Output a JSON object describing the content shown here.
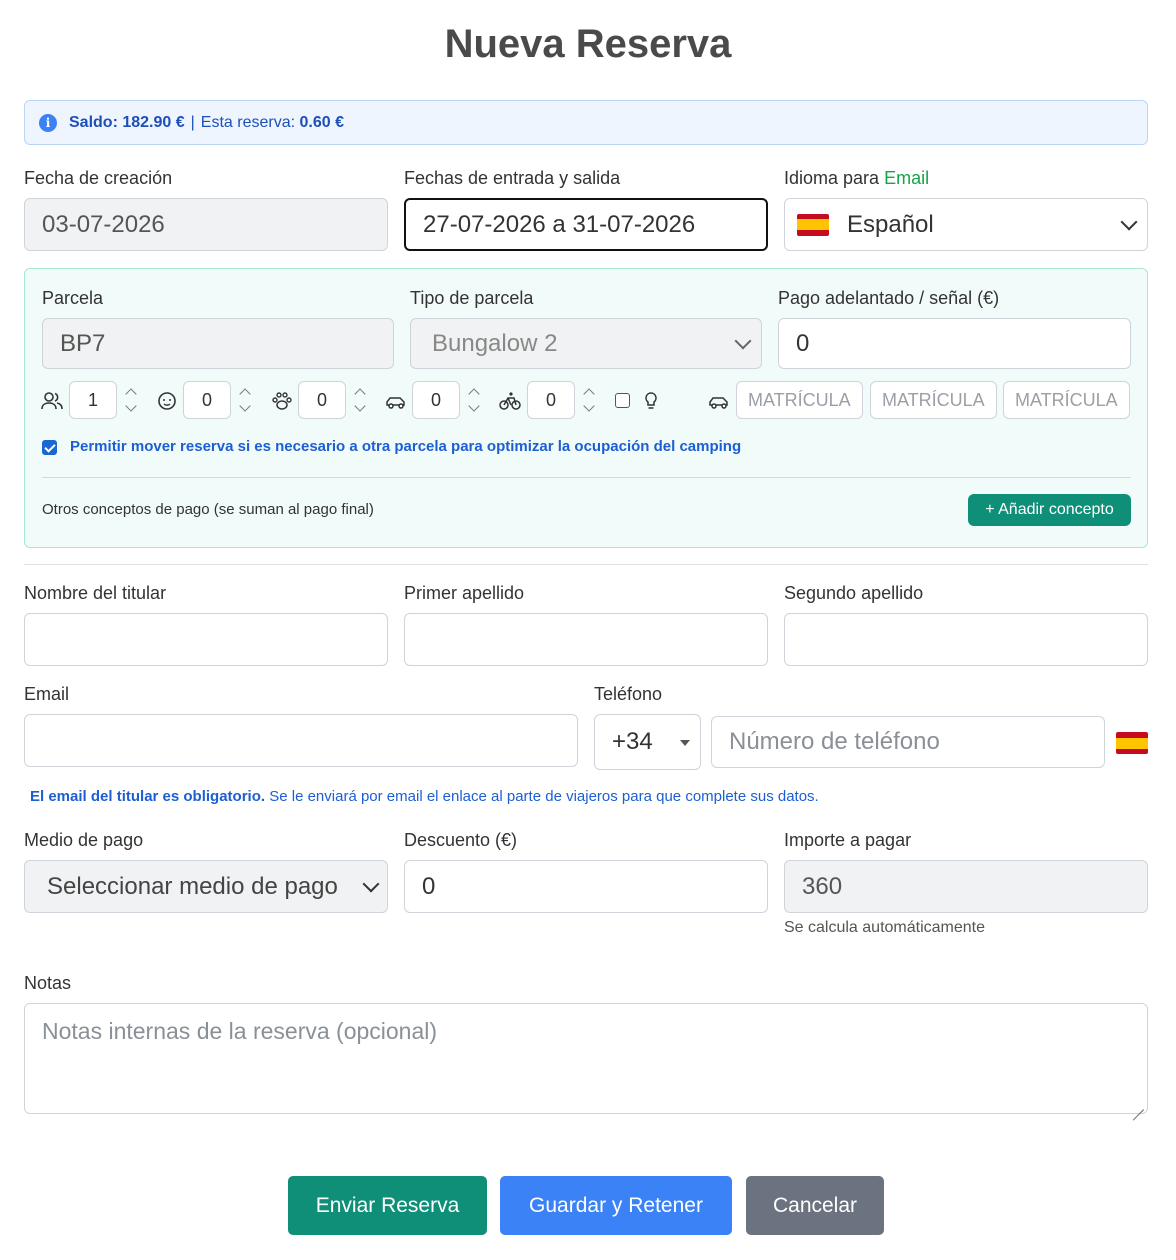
{
  "page": {
    "title": "Nueva Reserva"
  },
  "alert": {
    "saldo": "Saldo: 182.90 €",
    "sep": "|",
    "reserva_label": "Esta reserva:",
    "reserva_value": "0.60 €"
  },
  "fields": {
    "fecha_creacion": {
      "label": "Fecha de creación",
      "value": "03-07-2026"
    },
    "fechas": {
      "label": "Fechas de entrada y salida",
      "value": "27-07-2026 a 31-07-2026"
    },
    "idioma": {
      "label": "Idioma para",
      "label_accent": "Email",
      "value": "Español"
    }
  },
  "panel": {
    "parcela": {
      "label": "Parcela",
      "value": "BP7"
    },
    "tipo": {
      "label": "Tipo de parcela",
      "value": "Bungalow 2"
    },
    "pago": {
      "label": "Pago adelantado / señal (€)",
      "value": "0"
    },
    "counters": [
      {
        "icon": "people-icon",
        "glyph": "👥",
        "value": "1"
      },
      {
        "icon": "baby-icon",
        "glyph": "☺",
        "value": "0"
      },
      {
        "icon": "paw-icon",
        "glyph": "🐾",
        "value": "0"
      },
      {
        "icon": "car-icon",
        "glyph": "🚗",
        "value": "0"
      },
      {
        "icon": "bicycle-icon",
        "glyph": "🚲",
        "value": "0"
      }
    ],
    "plates": [
      "MATRÍCULA",
      "MATRÍCULA",
      "MATRÍCULA"
    ],
    "permitir": "Permitir mover reserva si es necesario a otra parcela para optimizar la ocupación del camping",
    "otros": "Otros conceptos de pago (se suman al pago final)",
    "add_button": "+ Añadir concepto"
  },
  "titular": {
    "nombre": {
      "label": "Nombre del titular",
      "value": ""
    },
    "apellido1": {
      "label": "Primer apellido",
      "value": ""
    },
    "apellido2": {
      "label": "Segundo apellido",
      "value": ""
    },
    "email": {
      "label": "Email",
      "value": ""
    },
    "telefono": {
      "label": "Teléfono",
      "prefix": "+34",
      "placeholder": "Número de teléfono"
    },
    "note_bold": "El email del titular es obligatorio.",
    "note_rest": "Se le enviará por email el enlace al parte de viajeros para que complete sus datos."
  },
  "pago": {
    "medio": {
      "label": "Medio de pago",
      "value": "Seleccionar medio de pago"
    },
    "descuento": {
      "label": "Descuento (€)",
      "value": "0"
    },
    "importe": {
      "label": "Importe a pagar",
      "value": "360",
      "hint": "Se calcula automáticamente"
    }
  },
  "notas": {
    "label": "Notas",
    "placeholder": "Notas internas de la reserva (opcional)"
  },
  "buttons": {
    "enviar": "Enviar Reserva",
    "guardar": "Guardar y Retener",
    "cancelar": "Cancelar"
  },
  "colors": {
    "primary_green": "#0f8f78",
    "primary_blue": "#3b82f6",
    "gray": "#6b7280",
    "accent_email": "#16a34a"
  }
}
